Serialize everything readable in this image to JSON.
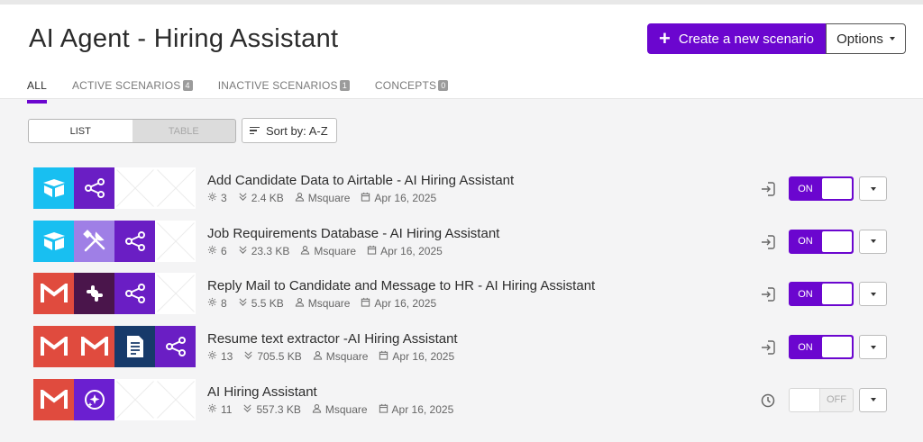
{
  "header": {
    "title": "AI Agent - Hiring Assistant",
    "create_label": "Create a new scenario",
    "options_label": "Options"
  },
  "tabs": [
    {
      "label": "ALL",
      "count": ""
    },
    {
      "label": "ACTIVE SCENARIOS",
      "count": "4"
    },
    {
      "label": "INACTIVE SCENARIOS",
      "count": "1"
    },
    {
      "label": "CONCEPTS",
      "count": "0"
    }
  ],
  "view": {
    "list_label": "LIST",
    "table_label": "TABLE",
    "selected": "LIST"
  },
  "sort": {
    "label": "Sort by: A-Z"
  },
  "colors": {
    "accent": "#6b06cf",
    "airtable": "#18bff1",
    "gmail": "#e04b3e",
    "slack": "#4a154b"
  },
  "scenarios": [
    {
      "title": "Add Candidate Data to Airtable - AI Hiring Assistant",
      "modules": "3",
      "size": "2.4 KB",
      "owner": "Msquare",
      "date": "Apr 16, 2025",
      "trigger": "instant-trigger-icon",
      "status": "ON",
      "apps": [
        "airtable-icon",
        "flow-control-icon"
      ]
    },
    {
      "title": "Job Requirements Database - AI Hiring Assistant",
      "modules": "6",
      "size": "23.3 KB",
      "owner": "Msquare",
      "date": "Apr 16, 2025",
      "trigger": "instant-trigger-icon",
      "status": "ON",
      "apps": [
        "airtable-icon",
        "tools-icon",
        "flow-control-icon"
      ]
    },
    {
      "title": "Reply Mail to Candidate and Message to HR - AI Hiring Assistant",
      "modules": "8",
      "size": "5.5 KB",
      "owner": "Msquare",
      "date": "Apr 16, 2025",
      "trigger": "instant-trigger-icon",
      "status": "ON",
      "apps": [
        "gmail-icon",
        "slack-icon",
        "flow-control-icon"
      ]
    },
    {
      "title": "Resume text extractor -AI Hiring Assistant",
      "modules": "13",
      "size": "705.5 KB",
      "owner": "Msquare",
      "date": "Apr 16, 2025",
      "trigger": "instant-trigger-icon",
      "status": "ON",
      "apps": [
        "gmail-icon",
        "gmail-icon",
        "text-parser-icon",
        "flow-control-icon"
      ]
    },
    {
      "title": "AI Hiring Assistant",
      "modules": "11",
      "size": "557.3 KB",
      "owner": "Msquare",
      "date": "Apr 16, 2025",
      "trigger": "clock-icon",
      "status": "OFF",
      "apps": [
        "gmail-icon",
        "ai-agent-icon"
      ]
    }
  ]
}
